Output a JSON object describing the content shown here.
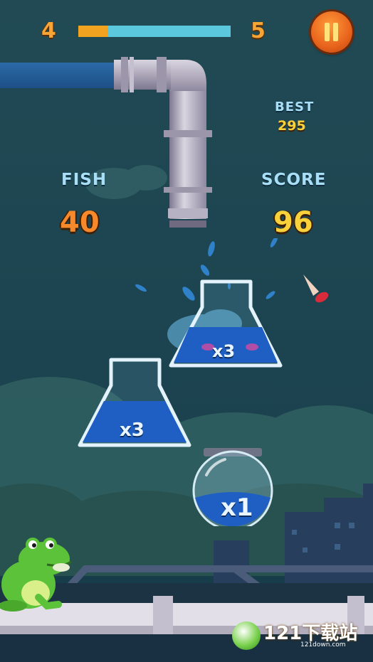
{
  "hud": {
    "current_level": "4",
    "next_level": "5",
    "progress": 0.19,
    "pause_icon": "pause-icon"
  },
  "best": {
    "label": "BEST",
    "value": "295"
  },
  "fish": {
    "label": "FISH",
    "value": "40"
  },
  "score": {
    "label": "SCORE",
    "value": "96"
  },
  "containers": [
    {
      "kind": "flask",
      "multiplier": "x3"
    },
    {
      "kind": "flask",
      "multiplier": "x3"
    },
    {
      "kind": "bowl",
      "multiplier": "x1"
    }
  ],
  "watermark": {
    "text": "121下载站",
    "subtext": "121down.com"
  },
  "colors": {
    "accent_orange": "#f7a534",
    "score_yellow": "#f9d13a",
    "progress_fill": "#f2a31f",
    "progress_track": "#5bc8de",
    "water": "#1f5fc3",
    "frog_green": "#5cc23a"
  }
}
